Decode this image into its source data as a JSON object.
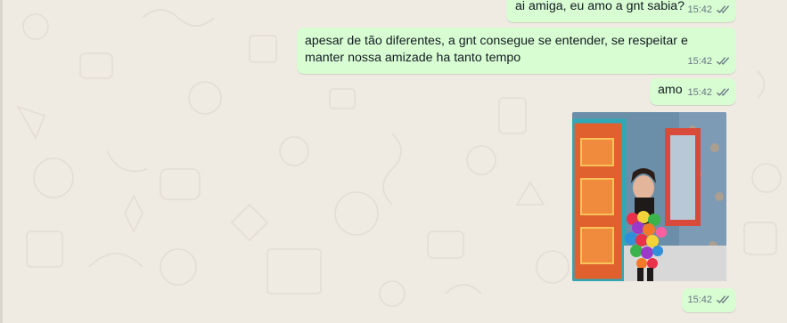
{
  "chat": {
    "messages": [
      {
        "text": "ai amiga, eu amo a gnt sabia?",
        "time": "15:42",
        "status": "read"
      },
      {
        "text": "apesar de tão diferentes, a gnt consegue se entender, se respeitar e manter nossa amizade ha tanto tempo",
        "time": "15:42",
        "status": "read"
      },
      {
        "text": "amo",
        "time": "15:42",
        "status": "read"
      },
      {
        "type": "image",
        "image_label": "person wearing colorful pom-pom outfit in decorated room",
        "time": "15:42",
        "status": "read"
      }
    ]
  },
  "colors": {
    "outgoing_bubble": "#d9fdd3",
    "background": "#efeae2",
    "meta_text": "#667781",
    "read_ticks": "#667781"
  },
  "icons": {
    "status": "double-check-icon"
  }
}
